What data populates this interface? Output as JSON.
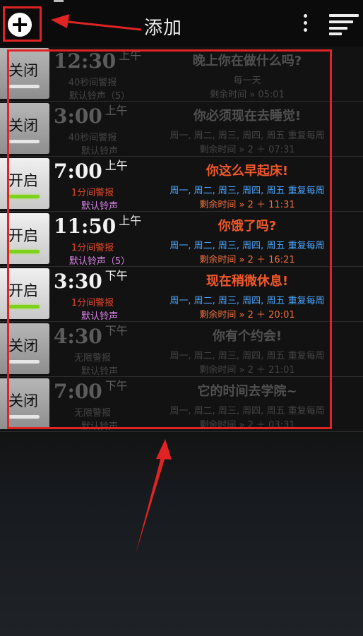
{
  "header": {
    "title": "添加",
    "add_icon": "plus-circle-icon",
    "menu_icon": "kebab-menu-icon",
    "sort_icon": "sort-lines-icon"
  },
  "alarms": [
    {
      "state": "off",
      "toggle_label": "关闭",
      "time": "12:30",
      "ampm": "上午",
      "alert": "40秒间警报",
      "ringtone": "默认铃声（5）",
      "label": "晚上你在做什么吗?",
      "repeat": "每一天",
      "remaining": "剩余时间 » 05:01"
    },
    {
      "state": "off",
      "toggle_label": "关闭",
      "time": "3:00",
      "ampm": "上午",
      "alert": "40秒间警报",
      "ringtone": "默认铃声",
      "label": "你必须现在去睡觉!",
      "repeat": "周一, 周二, 周三, 周四, 周五 重复每周",
      "remaining": "剩余时间 » 2 ＋ 07:31"
    },
    {
      "state": "on",
      "toggle_label": "开启",
      "time": "7:00",
      "ampm": "上午",
      "alert": "1分间警报",
      "ringtone": "默认铃声",
      "label": "你这么早起床!",
      "repeat": "周一, 周二, 周三, 周四, 周五 重复每周",
      "remaining": "剩余时间 » 2 ＋ 11:31"
    },
    {
      "state": "on",
      "toggle_label": "开启",
      "time": "11:50",
      "ampm": "上午",
      "alert": "1分间警报",
      "ringtone": "默认铃声（5）",
      "label": "你饿了吗?",
      "repeat": "周一, 周二, 周三, 周四, 周五 重复每周",
      "remaining": "剩余时间 » 2 ＋ 16:21"
    },
    {
      "state": "on",
      "toggle_label": "开启",
      "time": "3:30",
      "ampm": "下午",
      "alert": "1分间警报",
      "ringtone": "默认铃声",
      "label": "现在稍微休息!",
      "repeat": "周一, 周二, 周三, 周四, 周五 重复每周",
      "remaining": "剩余时间 » 2 ＋ 20:01"
    },
    {
      "state": "off",
      "toggle_label": "关闭",
      "time": "4:30",
      "ampm": "下午",
      "alert": "无限警报",
      "ringtone": "默认铃声",
      "label": "你有个约会!",
      "repeat": "周一, 周二, 周三, 周四, 周五 重复每周",
      "remaining": "剩余时间 » 2 ＋ 21:01"
    },
    {
      "state": "off",
      "toggle_label": "关闭",
      "time": "7:00",
      "ampm": "下午",
      "alert": "无限警报",
      "ringtone": "默认铃声",
      "label": "它的时间去学院~",
      "repeat": "周一, 周二, 周三, 周四, 周五 重复每周",
      "remaining": "剩余时间 » 2 ＋ 03:31"
    }
  ],
  "annotations": {
    "highlight_color": "#e02424"
  }
}
